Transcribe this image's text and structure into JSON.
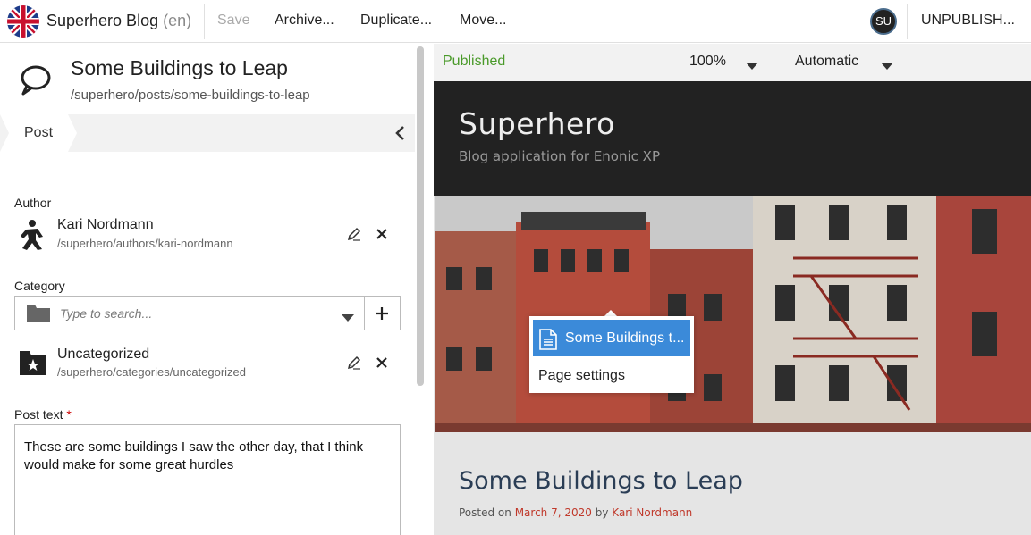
{
  "toolbar": {
    "app_name": "Superhero Blog",
    "language": "(en)",
    "save_label": "Save",
    "archive_label": "Archive...",
    "duplicate_label": "Duplicate...",
    "move_label": "Move...",
    "user_initials": "SU",
    "unpublish_label": "UNPUBLISH...",
    "icons": {
      "flag": "uk-flag-icon"
    }
  },
  "content": {
    "title": "Some Buildings to Leap",
    "path": "/superhero/posts/some-buildings-to-leap",
    "icon": "speech-bubble-icon"
  },
  "steps": [
    {
      "label": "Post"
    }
  ],
  "form": {
    "author": {
      "label": "Author",
      "name": "Kari Nordmann",
      "path": "/superhero/authors/kari-nordmann"
    },
    "category": {
      "label": "Category",
      "placeholder": "Type to search...",
      "selected_name": "Uncategorized",
      "selected_path": "/superhero/categories/uncategorized"
    },
    "post_text": {
      "label": "Post text",
      "required_marker": "*",
      "value": "These are some buildings I saw the other day, that I think would make for some great hurdles"
    }
  },
  "preview_bar": {
    "status": "Published",
    "zoom": "100%",
    "device": "Automatic",
    "colors": {
      "status": "#4a9a2a"
    }
  },
  "preview": {
    "site_name": "Superhero",
    "site_description": "Blog application for Enonic XP",
    "post_title": "Some Buildings to Leap",
    "posted_on_label": "Posted on",
    "post_date": "March 7, 2020",
    "by_label": "by",
    "post_author": "Kari Nordmann"
  },
  "context_menu": {
    "items": [
      {
        "label": "Some Buildings t...",
        "icon": "document-icon"
      },
      {
        "label": "Page settings"
      }
    ],
    "colors": {
      "active": "#3b8ad9"
    }
  }
}
